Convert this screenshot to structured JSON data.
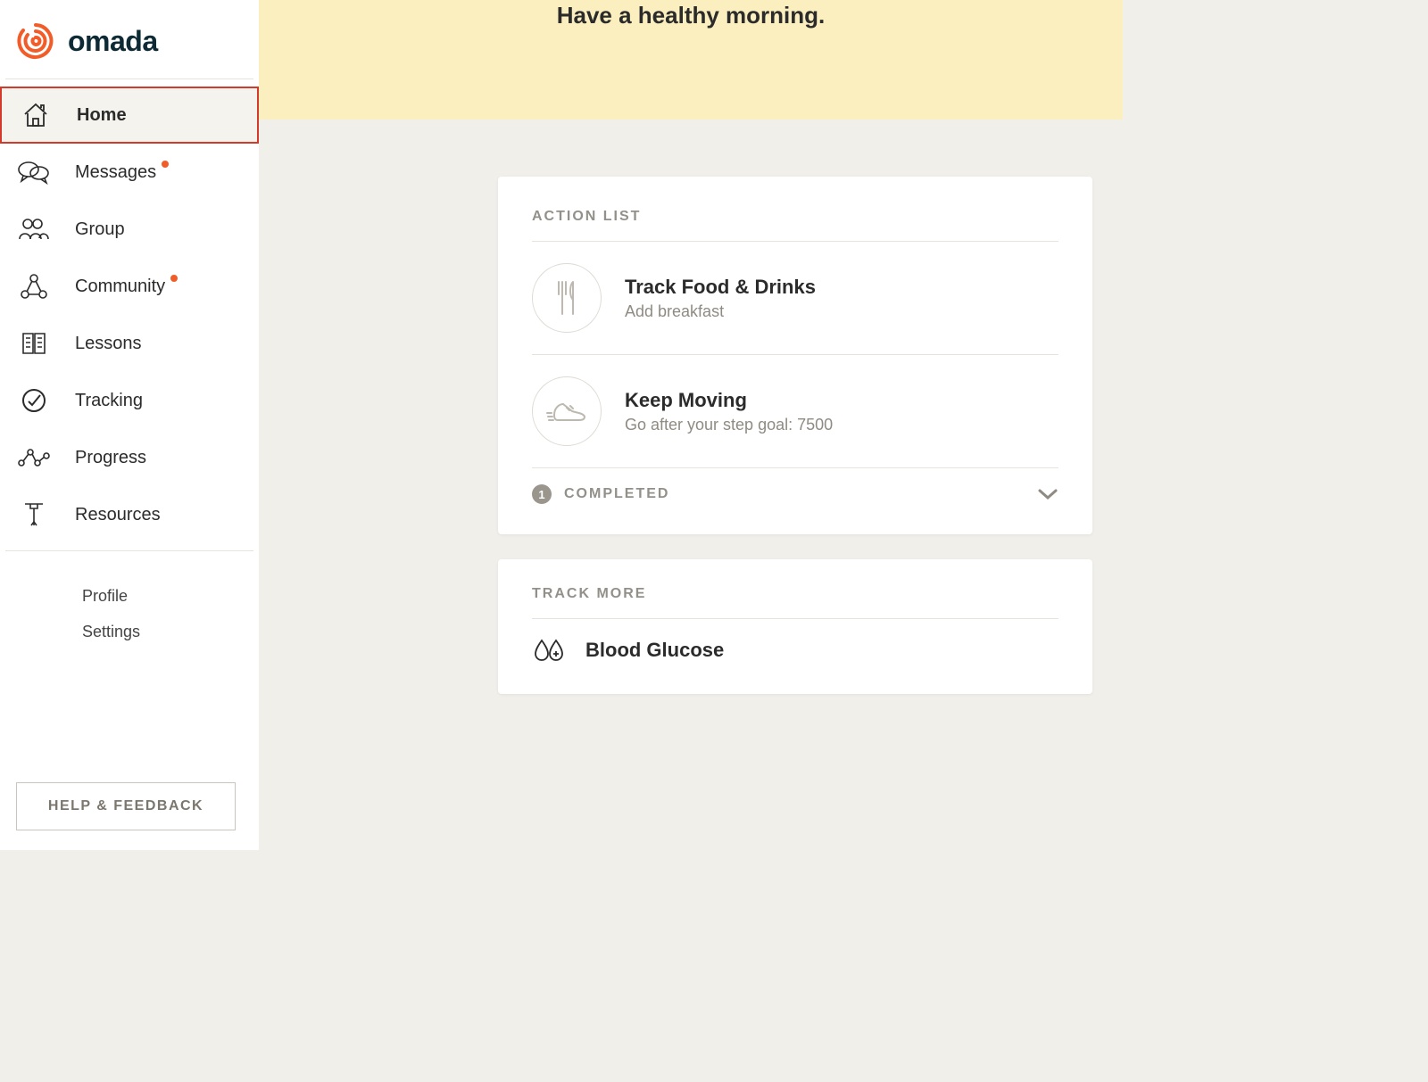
{
  "brand": {
    "name": "omada"
  },
  "sidebar": {
    "items": [
      {
        "label": "Home"
      },
      {
        "label": "Messages"
      },
      {
        "label": "Group"
      },
      {
        "label": "Community"
      },
      {
        "label": "Lessons"
      },
      {
        "label": "Tracking"
      },
      {
        "label": "Progress"
      },
      {
        "label": "Resources"
      }
    ],
    "sub": [
      {
        "label": "Profile"
      },
      {
        "label": "Settings"
      }
    ],
    "help_label": "HELP & FEEDBACK"
  },
  "banner": {
    "text": "Have a healthy morning."
  },
  "action_list": {
    "title": "ACTION LIST",
    "items": [
      {
        "title": "Track Food & Drinks",
        "subtitle": "Add breakfast"
      },
      {
        "title": "Keep Moving",
        "subtitle": "Go after your step goal: 7500"
      }
    ],
    "completed": {
      "count": "1",
      "label": "COMPLETED"
    }
  },
  "track_more": {
    "title": "TRACK MORE",
    "items": [
      {
        "title": "Blood Glucose"
      }
    ]
  }
}
